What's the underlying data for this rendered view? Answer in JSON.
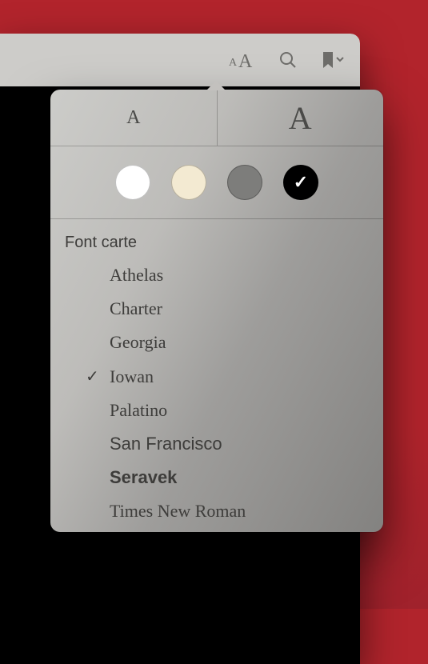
{
  "toolbar": {
    "icons": {
      "appearance": "text-size-icon",
      "search": "search-icon",
      "bookmark": "bookmark-icon"
    }
  },
  "popover": {
    "size_small_glyph": "A",
    "size_large_glyph": "A",
    "section_title": "Font carte",
    "themes": [
      {
        "name": "white",
        "color": "#ffffff",
        "selected": false
      },
      {
        "name": "sepia",
        "color": "#f3ead2",
        "selected": false
      },
      {
        "name": "gray",
        "color": "#7d7d7b",
        "selected": false
      },
      {
        "name": "night",
        "color": "#000000",
        "selected": true
      }
    ],
    "fonts": [
      {
        "label": "Athelas",
        "css": "f-athelas",
        "selected": false
      },
      {
        "label": "Charter",
        "css": "f-charter",
        "selected": false
      },
      {
        "label": "Georgia",
        "css": "f-georgia",
        "selected": false
      },
      {
        "label": "Iowan",
        "css": "f-iowan",
        "selected": true
      },
      {
        "label": "Palatino",
        "css": "f-palatino",
        "selected": false
      },
      {
        "label": "San Francisco",
        "css": "f-sanfran",
        "selected": false
      },
      {
        "label": "Seravek",
        "css": "f-seravek",
        "selected": false
      },
      {
        "label": "Times New Roman",
        "css": "f-times",
        "selected": false
      }
    ]
  }
}
